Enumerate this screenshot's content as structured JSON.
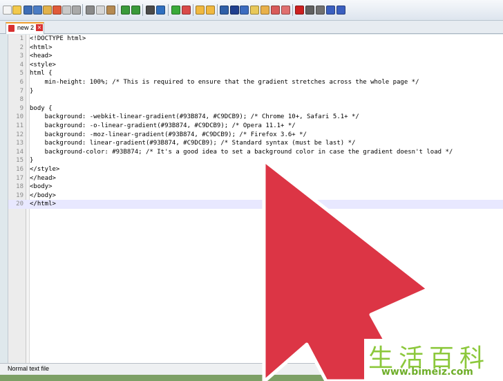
{
  "toolbar": {
    "buttons": [
      "new-file",
      "open-file",
      "save-file",
      "save-all",
      "close-file",
      "close-all",
      "print",
      "cut",
      "copy",
      "paste",
      "undo",
      "redo",
      "find",
      "replace",
      "zoom-in",
      "zoom-out",
      "sync-vertical",
      "sync-horizontal",
      "word-wrap",
      "show-all-chars",
      "indent-guide",
      "user-language",
      "doc-map",
      "function-list",
      "folder-as-workspace",
      "macro-record",
      "macro-stop",
      "macro-play",
      "macro-run-multiple",
      "macro-save"
    ]
  },
  "tab": {
    "label": "new 2",
    "close_glyph": "×"
  },
  "editor": {
    "lines": [
      {
        "n": "1",
        "text": "<!DOCTYPE html>"
      },
      {
        "n": "2",
        "text": "<html>"
      },
      {
        "n": "3",
        "text": "<head>"
      },
      {
        "n": "4",
        "text": "<style>"
      },
      {
        "n": "5",
        "text": "html {"
      },
      {
        "n": "6",
        "text": "    min-height: 100%; /* This is required to ensure that the gradient stretches across the whole page */"
      },
      {
        "n": "7",
        "text": "}"
      },
      {
        "n": "8",
        "text": ""
      },
      {
        "n": "9",
        "text": "body {"
      },
      {
        "n": "10",
        "text": "    background: -webkit-linear-gradient(#93B874, #C9DCB9); /* Chrome 10+, Safari 5.1+ */"
      },
      {
        "n": "11",
        "text": "    background: -o-linear-gradient(#93B874, #C9DCB9); /* Opera 11.1+ */"
      },
      {
        "n": "12",
        "text": "    background: -moz-linear-gradient(#93B874, #C9DCB9); /* Firefox 3.6+ */"
      },
      {
        "n": "13",
        "text": "    background: linear-gradient(#93B874, #C9DCB9); /* Standard syntax (must be last) */"
      },
      {
        "n": "14",
        "text": "    background-color: #93B874; /* It's a good idea to set a background color in case the gradient doesn't load */"
      },
      {
        "n": "15",
        "text": "}"
      },
      {
        "n": "16",
        "text": "</style>"
      },
      {
        "n": "17",
        "text": "</head>"
      },
      {
        "n": "18",
        "text": "<body>"
      },
      {
        "n": "19",
        "text": "</body>"
      },
      {
        "n": "20",
        "text": "</html>"
      }
    ],
    "current_line": 20
  },
  "statusbar": {
    "text": "Normal text file"
  },
  "watermark": {
    "chinese": "生活百科",
    "url": "www.bimeiz.com"
  },
  "colors": {
    "arrow_fill": "#dc3545",
    "arrow_stroke": "#ffffff",
    "accent_tab": "#f0a030",
    "watermark_green": "#8cc83c"
  }
}
